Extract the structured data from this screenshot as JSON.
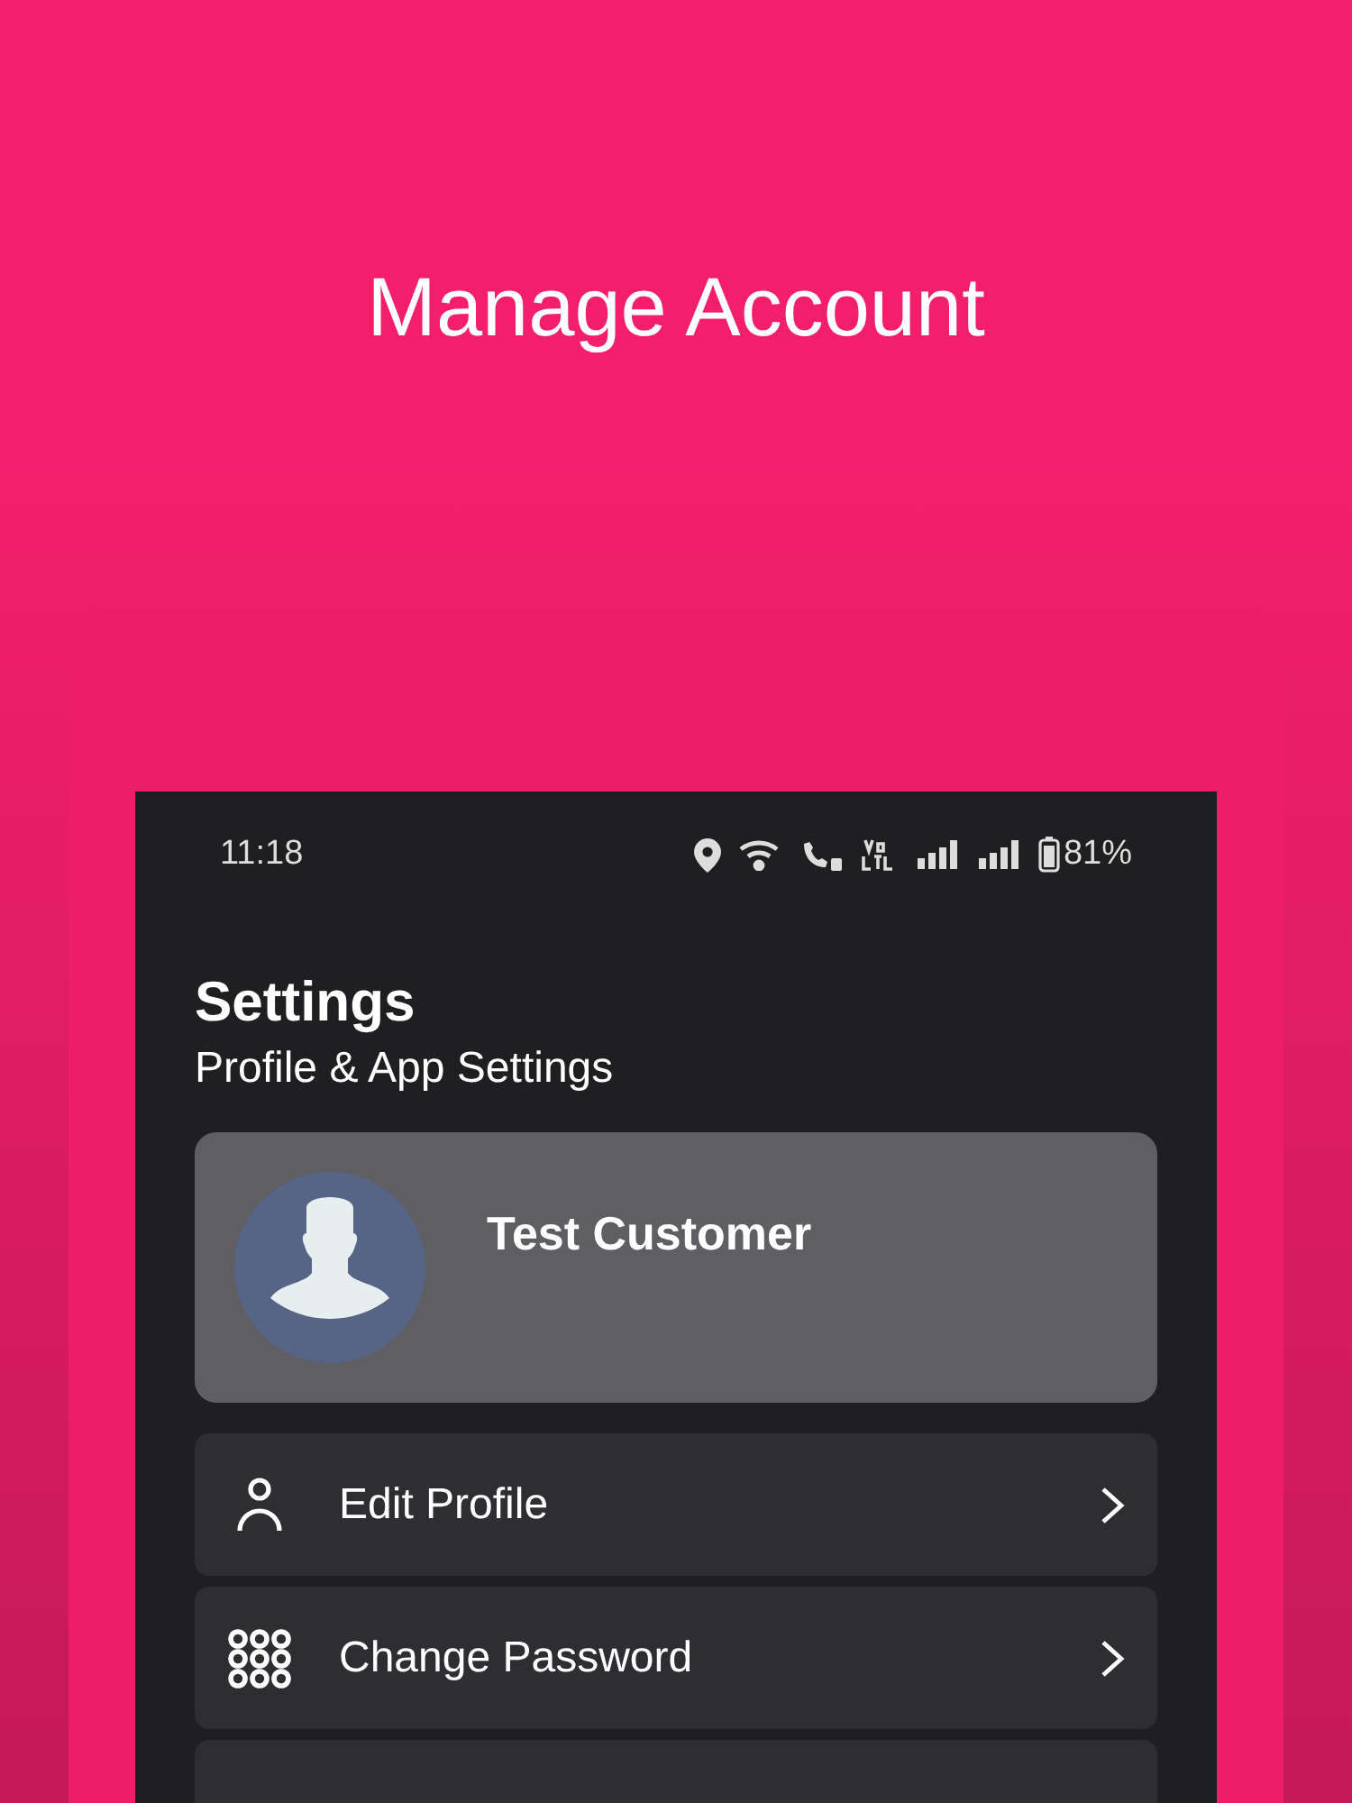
{
  "headline": "Manage Account",
  "status_bar": {
    "time": "11:18",
    "battery": "81%"
  },
  "header": {
    "title": "Settings",
    "subtitle": "Profile & App Settings"
  },
  "profile": {
    "name": "Test Customer"
  },
  "menu": [
    {
      "kind": "person",
      "label": "Edit Profile"
    },
    {
      "kind": "keypad",
      "label": "Change Password"
    }
  ]
}
